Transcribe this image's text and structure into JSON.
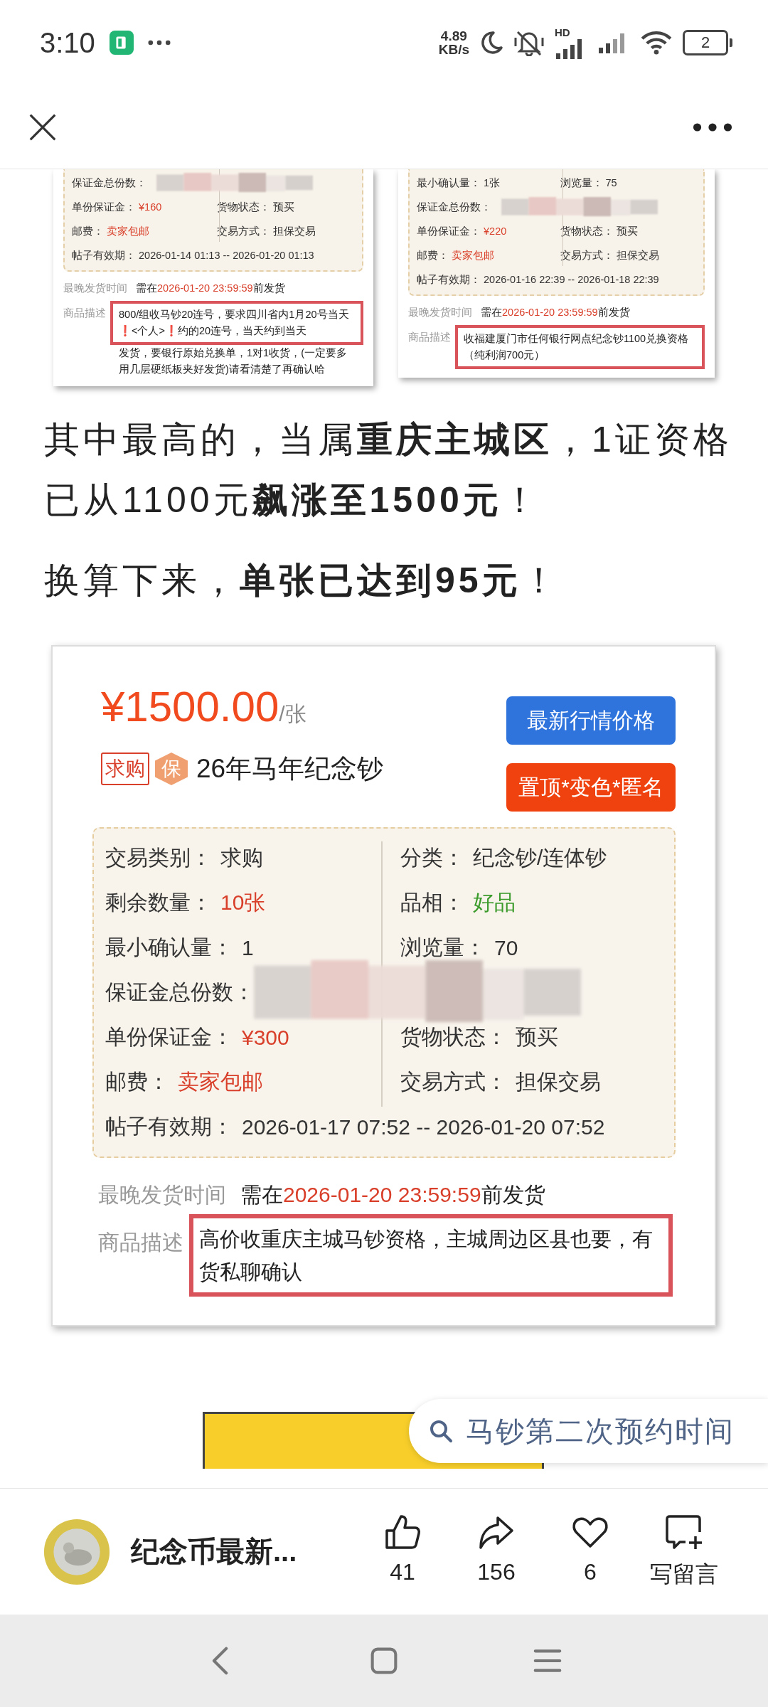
{
  "status_bar": {
    "time": "3:10",
    "net_speed": "4.89",
    "net_speed_unit": "KB/s",
    "hd_label": "HD",
    "battery": "2"
  },
  "embedded_screenshots": [
    {
      "rows": [
        {
          "kind": "redacted",
          "left": {
            "label": "保证金总份数："
          }
        },
        {
          "kind": "pair",
          "left": {
            "label": "单份保证金：",
            "value": "¥160",
            "color": "#d9402b"
          },
          "right": {
            "label": "货物状态：",
            "value": "预买"
          }
        },
        {
          "kind": "pair",
          "left": {
            "label": "邮费：",
            "value": "卖家包邮",
            "color": "#d9402b"
          },
          "right": {
            "label": "交易方式：",
            "value": "担保交易"
          }
        },
        {
          "kind": "full",
          "left": {
            "label": "帖子有效期：",
            "value": "2026-01-14 01:13 -- 2026-01-20 01:13"
          }
        }
      ],
      "deadline": {
        "label": "最晚发货时间",
        "prefix": "需在",
        "date": "2026-01-20 23:59:59",
        "suffix": "前发货"
      },
      "description": {
        "label": "商品描述",
        "boxed": "800/组收马钞20连号，要求四川省内1月20号当天❗<个人>❗约的20连号，当天约到当天",
        "rest": "发货，要银行原始兑换单，1对1收货，(一定要多用几层硬纸板夹好发货)请看清楚了再确认哈"
      }
    },
    {
      "rows": [
        {
          "kind": "pair",
          "left": {
            "label": "最小确认量：",
            "value": "1张"
          },
          "right": {
            "label": "浏览量：",
            "value": "75"
          }
        },
        {
          "kind": "redacted",
          "left": {
            "label": "保证金总份数："
          }
        },
        {
          "kind": "pair",
          "left": {
            "label": "单份保证金：",
            "value": "¥220",
            "color": "#d9402b"
          },
          "right": {
            "label": "货物状态：",
            "value": "预买"
          }
        },
        {
          "kind": "pair",
          "left": {
            "label": "邮费：",
            "value": "卖家包邮",
            "color": "#d9402b"
          },
          "right": {
            "label": "交易方式：",
            "value": "担保交易"
          }
        },
        {
          "kind": "full",
          "left": {
            "label": "帖子有效期：",
            "value": "2026-01-16 22:39 -- 2026-01-18 22:39"
          }
        }
      ],
      "deadline": {
        "label": "最晚发货时间",
        "prefix": "需在",
        "date": "2026-01-20 23:59:59",
        "suffix": "前发货"
      },
      "description": {
        "label": "商品描述",
        "boxed": "收福建厦门市任何银行网点纪念钞1100兑换资格（纯利润700元）"
      }
    }
  ],
  "paragraphs": [
    "其中最高的，当属**重庆主城区**，1证资格已从1100元**飙涨至1500元**！",
    "换算下来，**单张已达到95元**！"
  ],
  "listing": {
    "price": "¥1500.00",
    "unit": "/张",
    "tag": "求购",
    "badge": "保",
    "title": "26年马年纪念钞",
    "buttons": [
      {
        "label": "最新行情价格",
        "kind": "primary"
      },
      {
        "label": "置顶*变色*匿名",
        "kind": "promote"
      }
    ],
    "rows": [
      {
        "kind": "pair",
        "left": {
          "label": "交易类别：",
          "value": "求购"
        },
        "right": {
          "label": "分类：",
          "value": "纪念钞/连体钞"
        }
      },
      {
        "kind": "pair",
        "left": {
          "label": "剩余数量：",
          "value": "10张",
          "color": "#d9402b"
        },
        "right": {
          "label": "品相：",
          "value": "好品",
          "color": "#3a9a2a"
        }
      },
      {
        "kind": "pair",
        "left": {
          "label": "最小确认量：",
          "value": "1"
        },
        "right": {
          "label": "浏览量：",
          "value": "70"
        }
      },
      {
        "kind": "redacted",
        "left": {
          "label": "保证金总份数："
        }
      },
      {
        "kind": "pair",
        "left": {
          "label": "单份保证金：",
          "value": "¥300",
          "color": "#d9402b"
        },
        "right": {
          "label": "货物状态：",
          "value": "预买"
        }
      },
      {
        "kind": "pair",
        "left": {
          "label": "邮费：",
          "value": "卖家包邮",
          "color": "#d9402b"
        },
        "right": {
          "label": "交易方式：",
          "value": "担保交易"
        }
      },
      {
        "kind": "full",
        "left": {
          "label": "帖子有效期：",
          "value": "2026-01-17 07:52 -- 2026-01-20 07:52"
        }
      }
    ],
    "deadline": {
      "label": "最晚发货时间",
      "prefix": "需在",
      "date": "2026-01-20 23:59:59",
      "suffix": "前发货"
    },
    "description": {
      "label": "商品描述",
      "boxed": "高价收重庆主城马钞资格，主城周边区县也要，有货私聊确认"
    }
  },
  "search_chip": {
    "query": "马钞第二次预约时间"
  },
  "bottom_bar": {
    "account": "纪念币最新...",
    "actions": [
      {
        "kind": "like",
        "count": "41"
      },
      {
        "kind": "share",
        "count": "156"
      },
      {
        "kind": "favorite",
        "count": "6"
      },
      {
        "kind": "comment",
        "count": "写留言"
      }
    ]
  }
}
